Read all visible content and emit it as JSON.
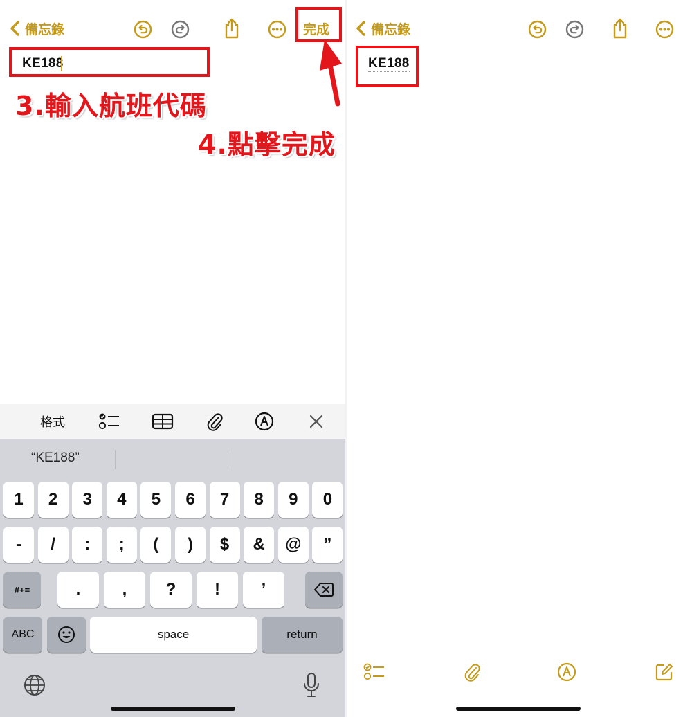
{
  "left": {
    "back_label": "備忘錄",
    "done_label": "完成",
    "note_text": "KE188",
    "instruction_3": "3.輸入航班代碼",
    "instruction_4": "4.點擊完成",
    "format_bar": {
      "format_label": "格式"
    },
    "keyboard": {
      "suggestion": "“KE188”",
      "row1": [
        "1",
        "2",
        "3",
        "4",
        "5",
        "6",
        "7",
        "8",
        "9",
        "0"
      ],
      "row2": [
        "-",
        "/",
        ":",
        ";",
        "(",
        ")",
        "$",
        "&",
        "@",
        "”"
      ],
      "row3_left": "#+=",
      "row3": [
        ".",
        ",",
        "?",
        "!",
        "’"
      ],
      "abc_label": "ABC",
      "space_label": "space",
      "return_label": "return"
    }
  },
  "right": {
    "back_label": "備忘錄",
    "note_text": "KE188"
  },
  "colors": {
    "accent": "#c49a1a",
    "annotation_red": "#e3161b",
    "keyboard_bg": "#d3d5db"
  }
}
